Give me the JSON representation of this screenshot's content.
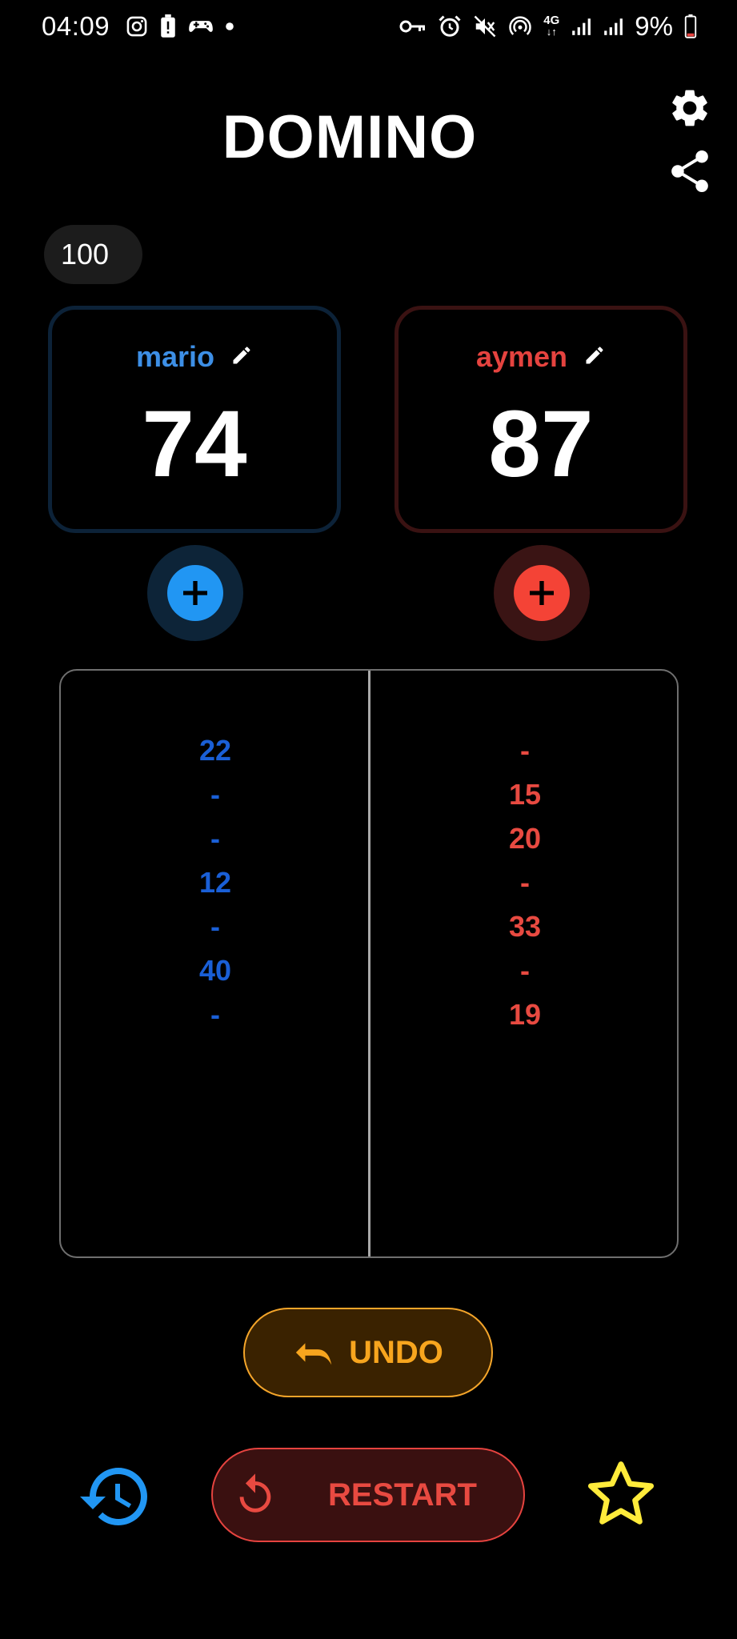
{
  "status_bar": {
    "time": "04:09",
    "battery": "9%",
    "network": "4G"
  },
  "header": {
    "title": "DOMINO"
  },
  "target_score": "100",
  "players": [
    {
      "name": "mario",
      "score": "74",
      "color": "#3d8fe6",
      "history": [
        "22",
        "-",
        "-",
        "12",
        "-",
        "40",
        "-"
      ]
    },
    {
      "name": "aymen",
      "score": "87",
      "color": "#e5433f",
      "history": [
        "-",
        "15",
        "20",
        "-",
        "33",
        "-",
        "19"
      ]
    }
  ],
  "actions": {
    "undo_label": "UNDO",
    "restart_label": "RESTART"
  },
  "colors": {
    "background": "#000000",
    "undo_accent": "#f7a51e",
    "restart_accent": "#e84a41",
    "history_icon": "#2196f3",
    "star_icon": "#ffeb3b"
  }
}
